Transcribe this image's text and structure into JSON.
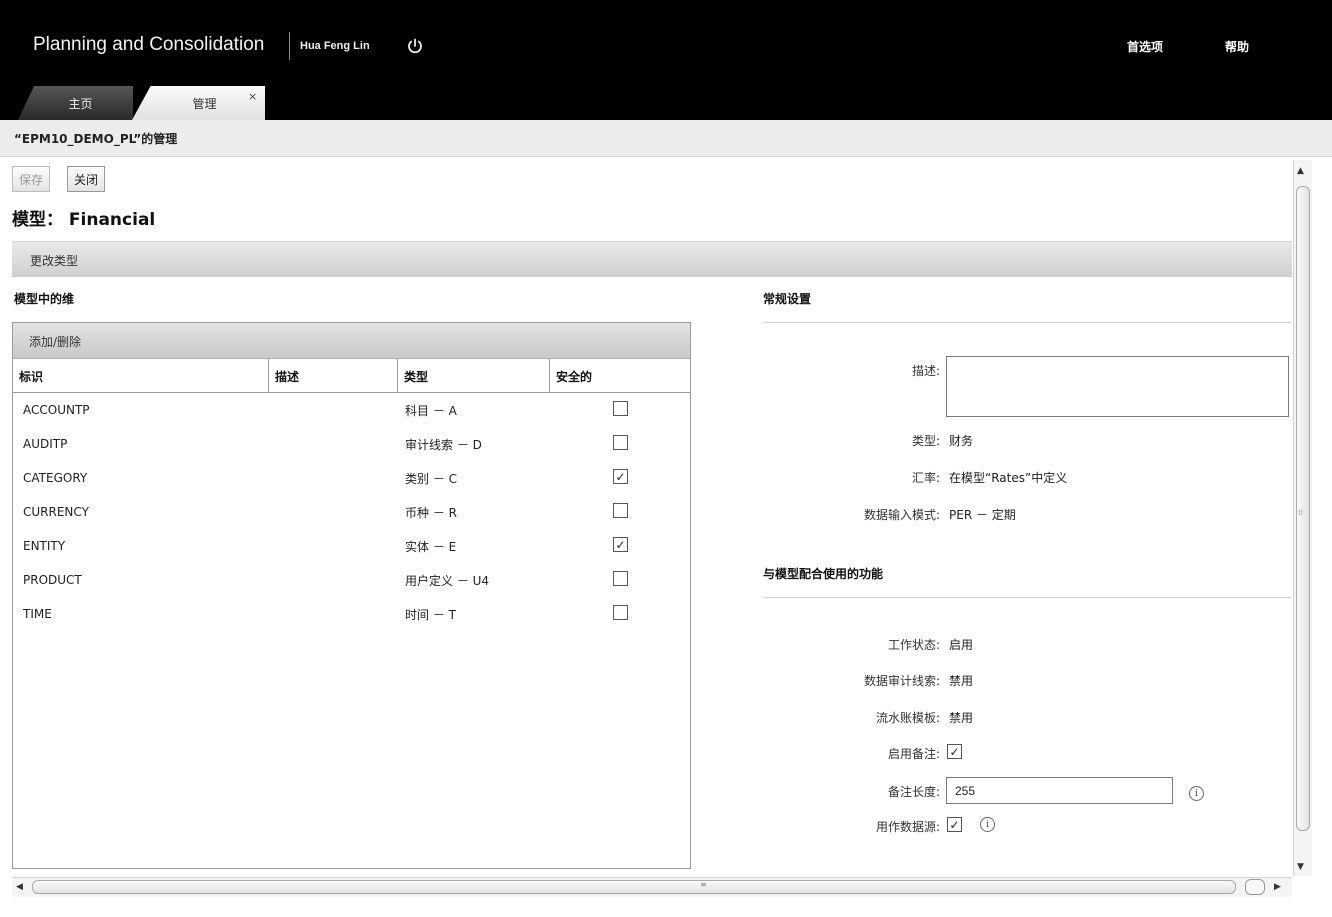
{
  "header": {
    "app_title": "Planning and Consolidation",
    "user_name": "Hua Feng Lin",
    "preferences_label": "首选项",
    "help_label": "帮助"
  },
  "tabs": [
    {
      "label": "主页",
      "active": false
    },
    {
      "label": "管理",
      "active": true,
      "closable": true
    }
  ],
  "tab_close_glyph": "×",
  "breadcrumb": "“EPM10_DEMO_PL”的管理",
  "toolbar": {
    "save_label": "保存",
    "close_label": "关闭"
  },
  "model_title": "模型： Financial",
  "change_type_label": "更改类型",
  "dimensions": {
    "heading": "模型中的维",
    "add_remove_label": "添加/删除",
    "columns": [
      "标识",
      "描述",
      "类型",
      "安全的"
    ],
    "rows": [
      {
        "id": "ACCOUNTP",
        "description": "",
        "type": "科目 － A",
        "secure": false
      },
      {
        "id": "AUDITP",
        "description": "",
        "type": "审计线索 － D",
        "secure": false
      },
      {
        "id": "CATEGORY",
        "description": "",
        "type": "类别 － C",
        "secure": true
      },
      {
        "id": "CURRENCY",
        "description": "",
        "type": "币种 － R",
        "secure": false
      },
      {
        "id": "ENTITY",
        "description": "",
        "type": "实体 － E",
        "secure": true
      },
      {
        "id": "PRODUCT",
        "description": "",
        "type": "用户定义 － U4",
        "secure": false
      },
      {
        "id": "TIME",
        "description": "",
        "type": "时间 － T",
        "secure": false
      }
    ]
  },
  "general_settings": {
    "heading": "常规设置",
    "description_label": "描述:",
    "description_value": "",
    "type_label": "类型:",
    "type_value": "财务",
    "rates_label": "汇率:",
    "rates_value": "在模型“Rates”中定义",
    "entry_mode_label": "数据输入模式:",
    "entry_mode_value": "PER － 定期"
  },
  "features": {
    "heading": "与模型配合使用的功能",
    "work_status_label": "工作状态:",
    "work_status_value": "启用",
    "audit_label": "数据审计线索:",
    "audit_value": "禁用",
    "journal_label": "流水账模板:",
    "journal_value": "禁用",
    "comments_label": "启用备注:",
    "comments_enabled": true,
    "comment_length_label": "备注长度:",
    "comment_length_value": "255",
    "source_label": "用作数据源:",
    "source_enabled": true
  },
  "check_glyph": "✓",
  "info_glyph": "i",
  "colors": {
    "header_bg": "#000000",
    "toolbar_gradient": "#d4d4d4",
    "border": "#9a9a9a"
  },
  "icons": [
    "power-icon",
    "close-icon",
    "info-icon",
    "checkbox-icon",
    "scroll-arrow-up-icon",
    "scroll-arrow-down-icon",
    "scroll-arrow-left-icon",
    "scroll-arrow-right-icon"
  ]
}
